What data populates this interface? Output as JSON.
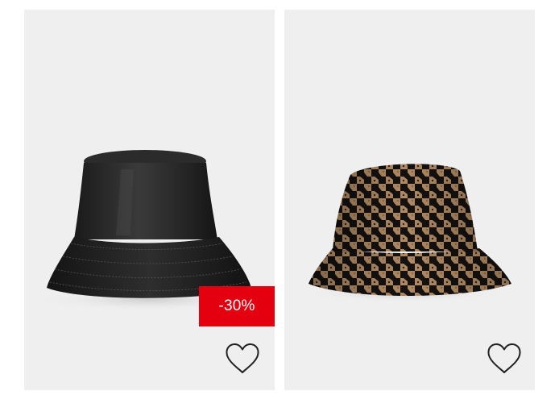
{
  "products": [
    {
      "image": "black-faux-leather-bucket-hat",
      "badge": "-30%",
      "favorite_icon": "heart-outline-icon"
    },
    {
      "image": "houndstooth-bucket-hat",
      "favorite_icon": "heart-outline-icon"
    }
  ],
  "colors": {
    "card_background": "#efefef",
    "sale_badge": "#e50010",
    "sale_text": "#ffffff"
  }
}
